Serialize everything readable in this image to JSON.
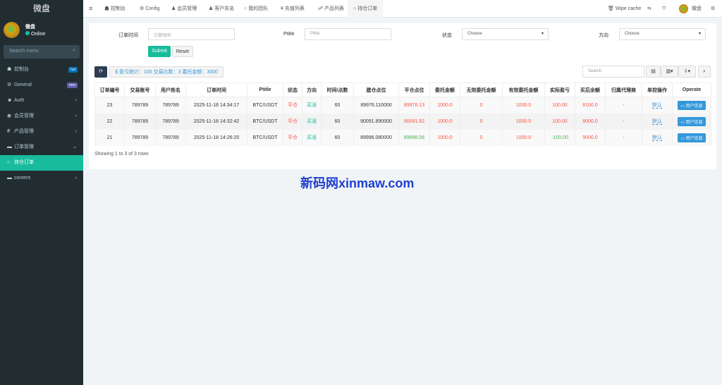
{
  "app": {
    "title": "微盘"
  },
  "user": {
    "name": "微盘",
    "status": "Online"
  },
  "sidebar": {
    "search_placeholder": "Search menu",
    "items": [
      {
        "label": "控制台",
        "icon": "dashboard-icon",
        "badge": "hot",
        "badge_color": "#0073b7"
      },
      {
        "label": "General",
        "icon": "cogs-icon",
        "badge": "new",
        "badge_color": "#605ca8"
      },
      {
        "label": "Auth",
        "icon": "group-icon",
        "arrow": "‹"
      },
      {
        "label": "会员管理",
        "icon": "user-circle-icon",
        "arrow": "‹"
      },
      {
        "label": "产品管理",
        "icon": "product-icon",
        "arrow": "‹"
      },
      {
        "label": "订单管理",
        "icon": "list-icon",
        "arrow": "⌄"
      },
      {
        "label": "持仓订单",
        "icon": "circle-icon",
        "active": true
      },
      {
        "label": "content",
        "icon": "list-icon",
        "arrow": "‹"
      }
    ]
  },
  "topnav": {
    "tabs": [
      "控制台",
      "Config",
      "会员管理",
      "客户实名",
      "我的团队",
      "充值列表",
      "产品列表",
      "持仓订单"
    ],
    "active": "持仓订单",
    "wipe_cache": "Wipe cache",
    "user": "微盘"
  },
  "filters": {
    "order_time_label": "订单时间",
    "order_time_placeholder": "订单时间",
    "ptitle_label": "Ptitle",
    "ptitle_placeholder": "Ptitle",
    "status_label": "状态",
    "status_value": "Choose",
    "direction_label": "方向",
    "direction_value": "Choose",
    "submit": "Submit",
    "reset": "Reset"
  },
  "toolbar": {
    "stats": "$ 盈亏统计：100 交易比数：3 委托金额：3000",
    "search_placeholder": "Search"
  },
  "table": {
    "columns": [
      "订单编号",
      "交易账号",
      "用户姓名",
      "订单时间",
      "Ptitle",
      "状态",
      "方向",
      "时间/点数",
      "建仓点位",
      "平仓点位",
      "委托金额",
      "无效委托金额",
      "有效委托金额",
      "实际盈亏",
      "买后余额",
      "归属代理商",
      "单控操作",
      "Operate"
    ],
    "rows": [
      [
        "23",
        "789789",
        "789789",
        "2025-11-18 14:34:17",
        "BTC/USDT",
        "平仓",
        "买涨",
        "60",
        "89976.110000",
        "89976.13",
        "1000.0",
        "0",
        "1000.0",
        "100.00",
        "8100.0",
        "-",
        "默认",
        "用户信息"
      ],
      [
        "22",
        "789789",
        "789789",
        "2025-11-18 14:32:42",
        "BTC/USDT",
        "平仓",
        "买涨",
        "60",
        "90091.890000",
        "90091.92",
        "1000.0",
        "0",
        "1000.0",
        "100.00",
        "8000.0",
        "-",
        "默认",
        "用户信息"
      ],
      [
        "21",
        "789789",
        "789789",
        "2025-11-18 14:26:20",
        "BTC/USDT",
        "平仓",
        "买涨",
        "60",
        "89996.080000",
        "89996.06",
        "1000.0",
        "0",
        "1000.0",
        "-100.00",
        "9000.0",
        "-",
        "默认",
        "用户信息"
      ]
    ],
    "footer": "Showing 1 to 3 of 3 rows"
  },
  "watermark": "新码网xinmaw.com"
}
